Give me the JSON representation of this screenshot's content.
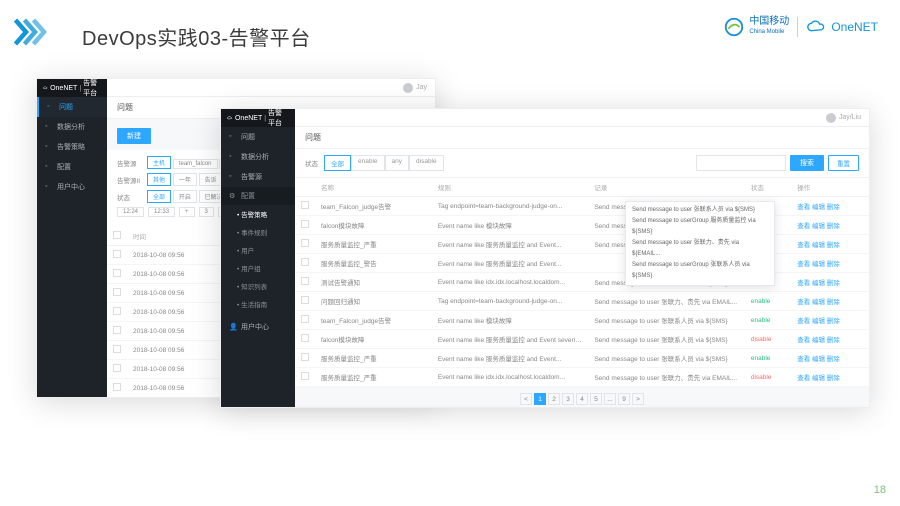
{
  "slide": {
    "title": "DevOps实践03-告警平台",
    "page_number": "18",
    "brand_cm_cn": "中国移动",
    "brand_cm_en": "China Mobile",
    "brand_onenet": "OneNET"
  },
  "back": {
    "logo_prefix": "OneNET",
    "logo_suffix": "告警平台",
    "user": "Jay",
    "sidebar": [
      {
        "label": "问题",
        "active": true
      },
      {
        "label": "数据分析"
      },
      {
        "label": "告警策略"
      },
      {
        "label": "配置"
      },
      {
        "label": "用户中心"
      }
    ],
    "crumb": "问题",
    "new_btn": "新建",
    "filter1_lbl": "告警源",
    "filter1_pills": [
      "主机",
      "team_falcon",
      "GSP_013..."
    ],
    "filter2_lbl": "告警源II",
    "filter2_pills": [
      "其他",
      "一年",
      "告诉"
    ],
    "filter3_lbl": "状态",
    "filter3_pills": [
      "全部",
      "开启",
      "已解决"
    ],
    "time_range": [
      "12:24",
      "12:33",
      "+",
      "3",
      "=",
      "3",
      "+"
    ],
    "table": {
      "cols": [
        "",
        "时间"
      ],
      "rows": [
        {
          "time": "2018-10-08 09:56"
        },
        {
          "time": "2018-10-08 09:56"
        },
        {
          "time": "2018-10-08 09:56"
        },
        {
          "time": "2018-10-08 09:56"
        },
        {
          "time": "2018-10-08 09:56"
        },
        {
          "time": "2018-10-08 09:56"
        },
        {
          "time": "2018-10-08 09:56"
        },
        {
          "time": "2018-10-08 09:56"
        }
      ]
    }
  },
  "front": {
    "logo_prefix": "OneNET",
    "logo_suffix": "告警平台",
    "user": "Jay/Liu",
    "sidebar_main": [
      {
        "label": "问题"
      },
      {
        "label": "数据分析"
      },
      {
        "label": "告警源"
      }
    ],
    "sidebar_section": "配置",
    "sidebar_subs": [
      {
        "label": "告警策略",
        "active": true
      },
      {
        "label": "事件规则"
      },
      {
        "label": "用户"
      },
      {
        "label": "用户组"
      },
      {
        "label": "知识列表"
      },
      {
        "label": "生活指南"
      }
    ],
    "sidebar_bottom": "用户中心",
    "crumb": "问题",
    "status_lbl": "状态",
    "status_tabs": [
      "全部",
      "enable",
      "any",
      "disable"
    ],
    "search_placeholder": " ",
    "btn_search": "搜索",
    "btn_reset": "重置",
    "table": {
      "cols": [
        "",
        "名称",
        "规则",
        "记录",
        "状态",
        "操作"
      ],
      "rows": [
        {
          "name": "team_Falcon_judge告警",
          "rule": "Tag endpoint=team-background-judge-on...",
          "rec": "Send message to user 张联系人员 via ${SMS}",
          "status": "enable",
          "ops": "查看 编辑 删除"
        },
        {
          "name": "falcon模块故障",
          "rule": "Event name like 模块故障",
          "rec": "Send message to user 张联系人员 via ${SMS}",
          "status": "enable",
          "ops": "查看 编辑 删除"
        },
        {
          "name": "服务质量监控_严重",
          "rule": "Event name like 服务质量监控 and Event...",
          "rec": "Send message to user 张联系人员 via ${SMS}",
          "status": "disable",
          "ops": "查看 编辑 删除"
        },
        {
          "name": "服务质量监控_警告",
          "rule": "Event name like 服务质量监控 and Event...",
          "rec": "",
          "status": "enable",
          "ops": "查看 编辑 删除"
        },
        {
          "name": "测试告警通知",
          "rule": "Event name like idx.idx.localhost.localdom...",
          "rec": "Send message to user 张联系人员 via ${SMS}",
          "status": "enable",
          "ops": "查看 编辑 删除"
        },
        {
          "name": "问题回归通知",
          "rule": "Tag endpoint=team-background-judge-on...",
          "rec": "Send message to user 张联力、贵先 via EMAIL...",
          "status": "enable",
          "ops": "查看 编辑 删除"
        },
        {
          "name": "team_Falcon_judge告警",
          "rule": "Event name like 模块故障",
          "rec": "Send message to user 张联系人员 via ${SMS}",
          "status": "enable",
          "ops": "查看 编辑 删除"
        },
        {
          "name": "falcon模块故障",
          "rule": "Event name like 服务质量监控 and Event severity=warning",
          "rec": "Send message to user 张联系人员 via ${SMS}",
          "status": "disable",
          "ops": "查看 编辑 删除"
        },
        {
          "name": "服务质量监控_严重",
          "rule": "Event name like 服务质量监控 and Event...",
          "rec": "Send message to user 张联系人员 via ${SMS}",
          "status": "enable",
          "ops": "查看 编辑 删除"
        },
        {
          "name": "服务质量监控_严重",
          "rule": "Event name like idx.idx.localhost.localdom...",
          "rec": "Send message to user 张联力、贵先 via EMAIL...",
          "status": "disable",
          "ops": "查看 编辑 删除"
        }
      ]
    },
    "popup": [
      "Send message to user 张联系人员 via ${SMS}",
      "Send message to userGroup 服务质量监控 via ${SMS}",
      "Send message to user 张联力、贵先 via ${EMAIL...",
      "Send message to userGroup 张联系人员 via ${SMS}"
    ],
    "pager": [
      "<",
      "1",
      "2",
      "3",
      "4",
      "5",
      "...",
      "9",
      ">"
    ]
  }
}
